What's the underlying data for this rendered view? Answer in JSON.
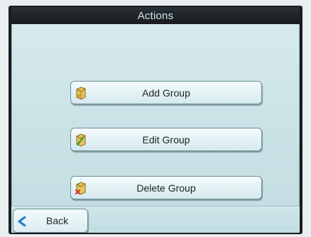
{
  "header": {
    "title": "Actions"
  },
  "menu": {
    "items": [
      {
        "label": "Add Group",
        "icon": "folder-add-icon"
      },
      {
        "label": "Edit Group",
        "icon": "folder-edit-icon"
      },
      {
        "label": "Delete Group",
        "icon": "folder-delete-icon"
      }
    ]
  },
  "footer": {
    "back_label": "Back",
    "back_icon": "chevron-left-icon"
  },
  "colors": {
    "title_bar": "#1d2125",
    "title_text": "#cfe6ec",
    "screen_bg": "#cfe6ea",
    "button_border": "#6d8f98",
    "back_arrow": "#1f7fd1"
  }
}
